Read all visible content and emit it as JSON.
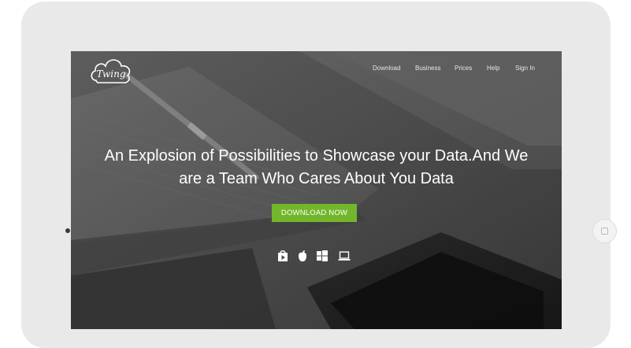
{
  "brand": {
    "logo_text": "Twing"
  },
  "nav": {
    "items": [
      {
        "label": "Download"
      },
      {
        "label": "Business"
      },
      {
        "label": "Prices"
      },
      {
        "label": "Help"
      },
      {
        "label": "Sign In"
      }
    ]
  },
  "hero": {
    "title_line1": "An Explosion of Possibilities to Showcase your Data.And We",
    "title_line2": "are a Team Who Cares About You Data",
    "cta_label": "DOWNLOAD NOW"
  },
  "platforms": [
    {
      "icon": "play-store-icon"
    },
    {
      "icon": "apple-icon"
    },
    {
      "icon": "windows-icon"
    },
    {
      "icon": "laptop-icon"
    }
  ],
  "colors": {
    "accent": "#73b62c",
    "tablet_frame": "#e9e9e9",
    "screen_bg": "#585858"
  }
}
